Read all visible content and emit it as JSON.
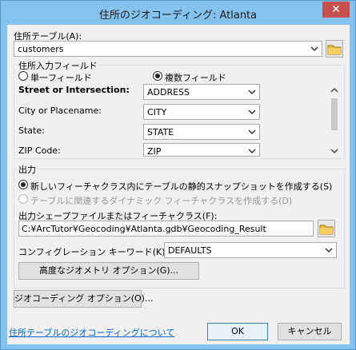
{
  "window": {
    "title": "住所のジオコーディング: Atlanta",
    "close": "✕"
  },
  "address_table": {
    "label": "住所テーブル(A):",
    "value": "customers"
  },
  "input_fields": {
    "group_title": "住所入力フィールド",
    "single_label": "単一フィールド",
    "multi_label": "複数フィールド",
    "rows": [
      {
        "label": "Street or Intersection:",
        "value": "ADDRESS",
        "bold": true
      },
      {
        "label": "City or Placename:",
        "value": "CITY",
        "bold": false
      },
      {
        "label": "State:",
        "value": "STATE",
        "bold": false
      },
      {
        "label": "ZIP Code:",
        "value": "ZIP",
        "bold": false
      }
    ]
  },
  "output": {
    "group_title": "出力",
    "option1": "新しいフィーチャクラス内にテーブルの静的スナップショットを作成する(S)",
    "option2": "テーブルに関連するダイナミック  フィーチャクラスを作成する(D)",
    "path_label": "出力シェープファイルまたはフィーチャクラス(F):",
    "path_value": "C:¥ArcTutor¥Geocoding¥Atlanta.gdb¥Geocoding_Result",
    "config_label": "コンフィグレーション キーワード(K):",
    "config_value": "DEFAULTS",
    "advanced_button": "高度なジオメトリ オプション(G)..."
  },
  "geocoding_options_button": "ジオコーディング オプション(O)...",
  "help_link": "住所テーブルのジオコーディングについて",
  "ok_button": "OK",
  "cancel_button": "キャンセル"
}
